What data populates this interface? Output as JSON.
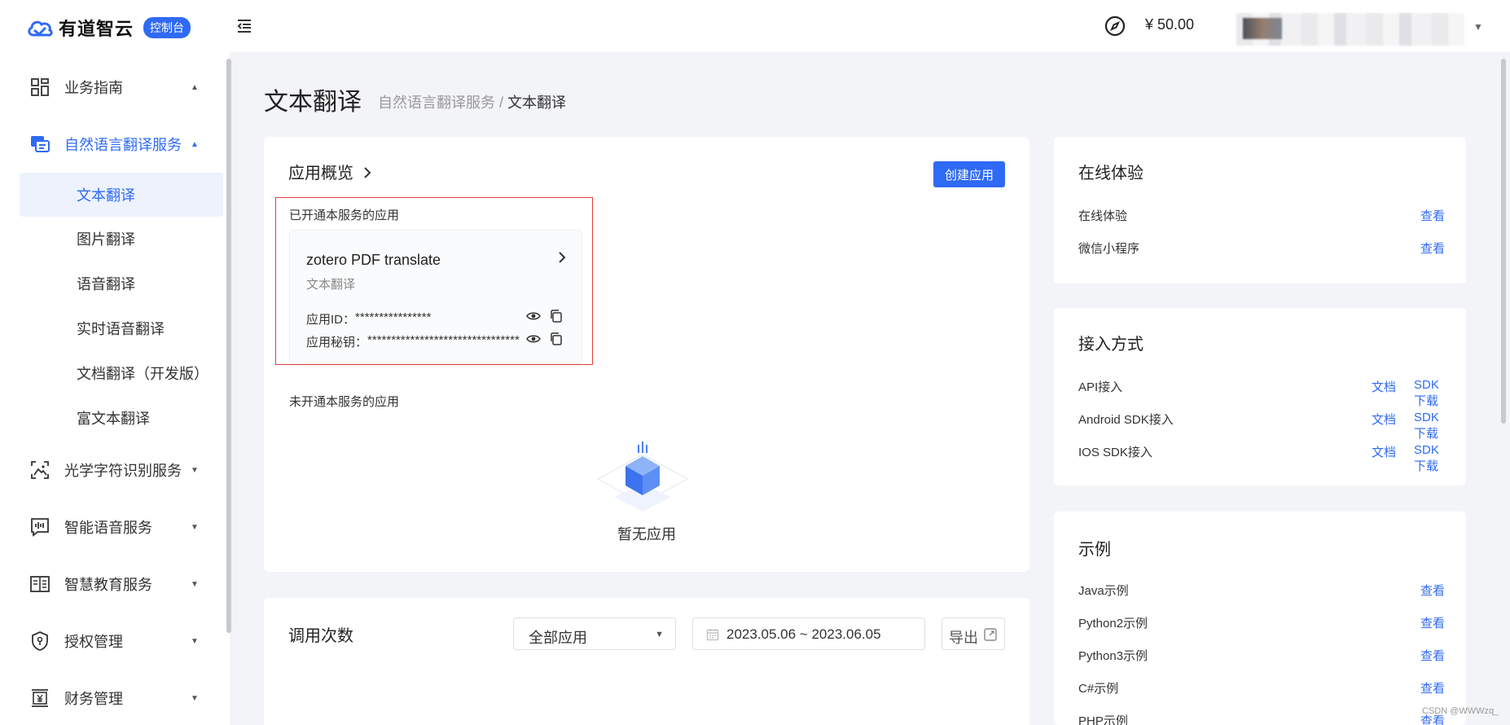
{
  "header": {
    "logo_text": "有道智云",
    "console_label": "控制台",
    "balance": "¥ 50.00"
  },
  "sidebar": {
    "groups": [
      {
        "label": "业务指南",
        "icon": "grid-icon",
        "expanded": true
      },
      {
        "label": "自然语言翻译服务",
        "icon": "translate-icon",
        "expanded": true,
        "active": true
      },
      {
        "label": "光学字符识别服务",
        "icon": "scan-image-icon",
        "expanded": false
      },
      {
        "label": "智能语音服务",
        "icon": "voice-wave-icon",
        "expanded": false
      },
      {
        "label": "智慧教育服务",
        "icon": "book-icon",
        "expanded": false
      },
      {
        "label": "授权管理",
        "icon": "shield-icon",
        "expanded": false
      },
      {
        "label": "财务管理",
        "icon": "yen-doc-icon",
        "expanded": false
      }
    ],
    "subitems": [
      {
        "label": "文本翻译",
        "active": true
      },
      {
        "label": "图片翻译"
      },
      {
        "label": "语音翻译"
      },
      {
        "label": "实时语音翻译"
      },
      {
        "label": "文档翻译（开发版）"
      },
      {
        "label": "富文本翻译"
      }
    ]
  },
  "page": {
    "title": "文本翻译",
    "breadcrumb_parent": "自然语言翻译服务",
    "breadcrumb_sep": " / ",
    "breadcrumb_current": "文本翻译"
  },
  "overview": {
    "title": "应用概览",
    "create_button": "创建应用",
    "enabled_label": "已开通本服务的应用",
    "app": {
      "name": "zotero PDF translate",
      "type": "文本翻译",
      "id_label": "应用ID：",
      "id_value": "****************",
      "secret_label": "应用秘钥：",
      "secret_value": "********************************"
    },
    "disabled_label": "未开通本服务的应用",
    "empty_text": "暂无应用"
  },
  "calls": {
    "title": "调用次数",
    "app_select": "全部应用",
    "date_range": "2023.05.06 ~ 2023.06.05",
    "export_label": "导出"
  },
  "online": {
    "title": "在线体验",
    "rows": [
      {
        "label": "在线体验",
        "link": "查看"
      },
      {
        "label": "微信小程序",
        "link": "查看"
      }
    ]
  },
  "access": {
    "title": "接入方式",
    "rows": [
      {
        "label": "API接入",
        "doc": "文档",
        "sdk": "SDK下载"
      },
      {
        "label": "Android SDK接入",
        "doc": "文档",
        "sdk": "SDK下载"
      },
      {
        "label": "IOS SDK接入",
        "doc": "文档",
        "sdk": "SDK下载"
      }
    ]
  },
  "examples": {
    "title": "示例",
    "rows": [
      {
        "label": "Java示例",
        "link": "查看"
      },
      {
        "label": "Python2示例",
        "link": "查看"
      },
      {
        "label": "Python3示例",
        "link": "查看"
      },
      {
        "label": "C#示例",
        "link": "查看"
      },
      {
        "label": "PHP示例",
        "link": "查看"
      }
    ]
  },
  "watermark": "CSDN @WWWzq_",
  "colors": {
    "accent": "#2f6af5",
    "highlight_border": "#e53a3a",
    "background": "#f3f4f7"
  }
}
